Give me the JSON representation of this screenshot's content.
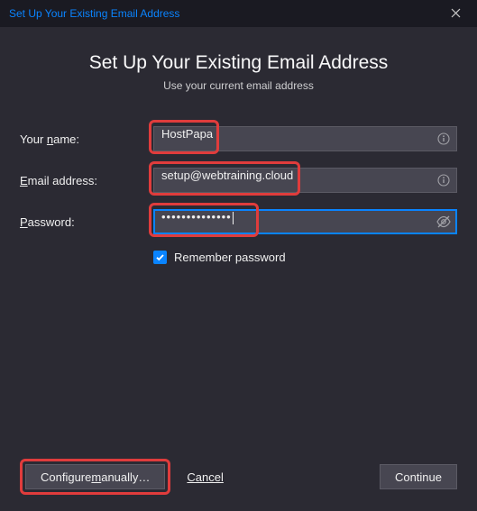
{
  "titlebar": {
    "title": "Set Up Your Existing Email Address"
  },
  "header": {
    "heading": "Set Up Your Existing Email Address",
    "subheading": "Use your current email address"
  },
  "form": {
    "name_label_prefix": "Your ",
    "name_label_ul": "n",
    "name_label_suffix": "ame:",
    "name_value": "HostPapa",
    "email_label_prefix": "",
    "email_label_ul": "E",
    "email_label_suffix": "mail address:",
    "email_value": "setup@webtraining.cloud",
    "password_label_prefix": "",
    "password_label_ul": "P",
    "password_label_suffix": "assword:",
    "password_mask": "••••••••••••••",
    "remember_label": "Remember password",
    "remember_checked": true
  },
  "footer": {
    "configure_prefix": "Configure ",
    "configure_ul": "m",
    "configure_suffix": "anually…",
    "cancel": "Cancel",
    "continue": "Continue"
  }
}
